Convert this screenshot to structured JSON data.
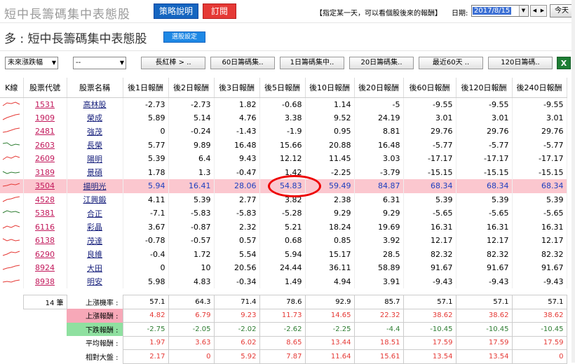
{
  "header": {
    "app_title": "短中長籌碼集中表態股",
    "strategy_button": "策略說明",
    "subscribe_button": "訂閱",
    "hint": "【指定某一天，可以看個股後來的報酬】",
    "date_label": "日期:",
    "date_value": "2017/8/15",
    "today_button": "今天"
  },
  "page": {
    "title": "多 : 短中長籌碼集中表態股",
    "select_button": "選股設定"
  },
  "filters": {
    "sort_select": "未來漲跌幅",
    "second_select": "--",
    "column_buttons": [
      "長紅棒 > ..",
      "60日籌碼集..",
      "1日籌碼集中..",
      "20日籌碼集..",
      "最近60天 ..",
      "120日籌碼.."
    ]
  },
  "table": {
    "headers": [
      "K線",
      "股票代號",
      "股票名稱",
      "後1日報酬",
      "後2日報酬",
      "後3日報酬",
      "後5日報酬",
      "後10日報酬",
      "後20日報酬",
      "後60日報酬",
      "後120日報酬",
      "後240日報酬"
    ],
    "rows": [
      {
        "code": "1531",
        "name": "高林股",
        "vals": [
          "-2.73",
          "-2.73",
          "1.82",
          "-0.68",
          "1.14",
          "-5",
          "-9.55",
          "-9.55",
          "-9.55"
        ]
      },
      {
        "code": "1909",
        "name": "榮成",
        "vals": [
          "5.89",
          "5.14",
          "4.76",
          "3.38",
          "9.52",
          "24.19",
          "3.01",
          "3.01",
          "3.01"
        ]
      },
      {
        "code": "2481",
        "name": "強茂",
        "vals": [
          "0",
          "-0.24",
          "-1.43",
          "-1.9",
          "0.95",
          "8.81",
          "29.76",
          "29.76",
          "29.76"
        ]
      },
      {
        "code": "2603",
        "name": "長榮",
        "vals": [
          "5.77",
          "9.89",
          "16.48",
          "15.66",
          "20.88",
          "16.48",
          "-5.77",
          "-5.77",
          "-5.77"
        ]
      },
      {
        "code": "2609",
        "name": "陽明",
        "vals": [
          "5.39",
          "6.4",
          "9.43",
          "12.12",
          "11.45",
          "3.03",
          "-17.17",
          "-17.17",
          "-17.17"
        ]
      },
      {
        "code": "3189",
        "name": "景碩",
        "vals": [
          "1.78",
          "1.3",
          "-0.47",
          "1.42",
          "-2.25",
          "-3.79",
          "-15.15",
          "-15.15",
          "-15.15"
        ]
      },
      {
        "code": "3504",
        "name": "揚明光",
        "vals": [
          "5.94",
          "16.41",
          "28.06",
          "54.83",
          "59.49",
          "84.87",
          "68.34",
          "68.34",
          "68.34"
        ],
        "highlight": true
      },
      {
        "code": "4528",
        "name": "江興鍛",
        "vals": [
          "4.11",
          "5.39",
          "2.77",
          "3.82",
          "2.38",
          "6.31",
          "5.39",
          "5.39",
          "5.39"
        ]
      },
      {
        "code": "5381",
        "name": "合正",
        "vals": [
          "-7.1",
          "-5.83",
          "-5.83",
          "-5.28",
          "9.29",
          "9.29",
          "-5.65",
          "-5.65",
          "-5.65"
        ]
      },
      {
        "code": "6116",
        "name": "彩晶",
        "vals": [
          "3.67",
          "-0.87",
          "2.32",
          "5.21",
          "18.24",
          "19.69",
          "16.31",
          "16.31",
          "16.31"
        ]
      },
      {
        "code": "6138",
        "name": "茂達",
        "vals": [
          "-0.78",
          "-0.57",
          "0.57",
          "0.68",
          "0.85",
          "3.92",
          "12.17",
          "12.17",
          "12.17"
        ]
      },
      {
        "code": "6290",
        "name": "良維",
        "vals": [
          "-0.4",
          "1.72",
          "5.54",
          "5.94",
          "15.17",
          "28.5",
          "82.32",
          "82.32",
          "82.32"
        ]
      },
      {
        "code": "8924",
        "name": "大田",
        "vals": [
          "0",
          "10",
          "20.56",
          "24.44",
          "36.11",
          "58.89",
          "91.67",
          "91.67",
          "91.67"
        ]
      },
      {
        "code": "8938",
        "name": "明安",
        "vals": [
          "5.98",
          "4.83",
          "-0.34",
          "1.49",
          "4.94",
          "3.91",
          "-9.43",
          "-9.43",
          "-9.43"
        ]
      }
    ]
  },
  "summary": {
    "count": "14 筆",
    "rows": [
      {
        "label": "上漲機率 :",
        "style": "plain",
        "vals": [
          "57.1",
          "64.3",
          "71.4",
          "78.6",
          "92.9",
          "85.7",
          "57.1",
          "57.1",
          "57.1"
        ]
      },
      {
        "label": "上漲報酬 :",
        "style": "red",
        "vals": [
          "4.82",
          "6.79",
          "9.23",
          "11.73",
          "14.65",
          "22.32",
          "38.62",
          "38.62",
          "38.62"
        ]
      },
      {
        "label": "下跌報酬 :",
        "style": "green",
        "vals": [
          "-2.75",
          "-2.05",
          "-2.02",
          "-2.62",
          "-2.25",
          "-4.4",
          "-10.45",
          "-10.45",
          "-10.45"
        ]
      },
      {
        "label": "平均報酬 :",
        "style": "red2",
        "vals": [
          "1.97",
          "3.63",
          "6.02",
          "8.65",
          "13.44",
          "18.51",
          "17.59",
          "17.59",
          "17.59"
        ]
      },
      {
        "label": "相對大盤 :",
        "style": "red2",
        "vals": [
          "2.17",
          "0",
          "5.92",
          "7.87",
          "11.64",
          "15.61",
          "13.54",
          "13.54",
          "0"
        ]
      }
    ]
  }
}
